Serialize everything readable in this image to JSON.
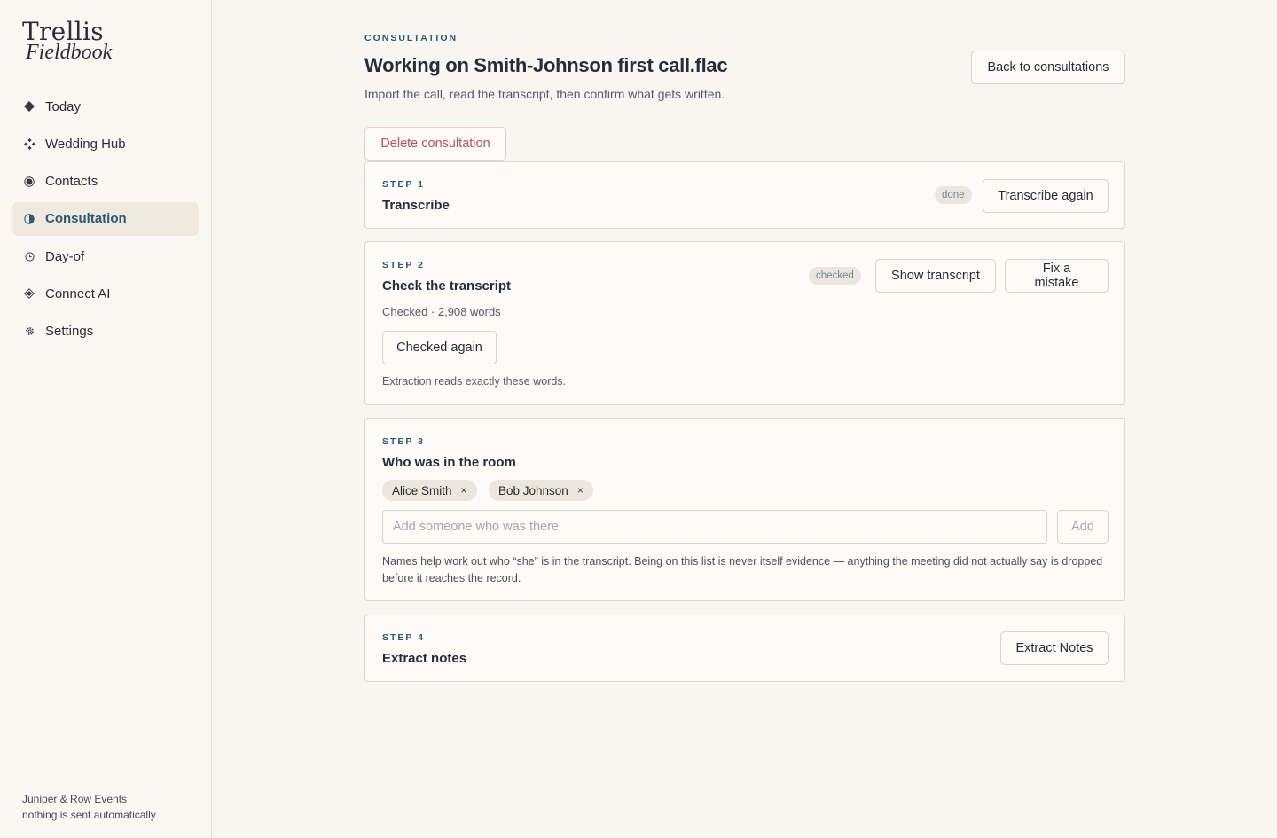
{
  "brand": {
    "name": "Trellis",
    "sub": "Fieldbook"
  },
  "nav": [
    {
      "label": "Today",
      "icon": "diamond-icon"
    },
    {
      "label": "Wedding Hub",
      "icon": "sparkle-cluster-icon"
    },
    {
      "label": "Contacts",
      "icon": "dot-circle-icon"
    },
    {
      "label": "Consultation",
      "icon": "half-circle-icon",
      "active": true
    },
    {
      "label": "Day-of",
      "icon": "clock-icon"
    },
    {
      "label": "Connect AI",
      "icon": "diamond-outline-icon"
    },
    {
      "label": "Settings",
      "icon": "gear-icon"
    }
  ],
  "footer": {
    "org": "Juniper & Row Events",
    "note": "nothing is sent automatically"
  },
  "header": {
    "kicker": "CONSULTATION",
    "title": "Working on Smith-Johnson first call.flac",
    "subtitle": "Import the call, read the transcript, then confirm what gets written.",
    "back_label": "Back to consultations",
    "delete_label": "Delete consultation"
  },
  "steps": {
    "s1": {
      "label": "STEP 1",
      "title": "Transcribe",
      "badge": "done",
      "action": "Transcribe again"
    },
    "s2": {
      "label": "STEP 2",
      "title": "Check the transcript",
      "badge": "checked",
      "show_label": "Show transcript",
      "fix_label": "Fix a mistake",
      "status": "Checked · 2,908 words",
      "again_label": "Checked again",
      "note": "Extraction reads exactly these words."
    },
    "s3": {
      "label": "STEP 3",
      "title": "Who was in the room",
      "people": [
        "Alice Smith",
        "Bob Johnson"
      ],
      "remove_glyph": "×",
      "placeholder": "Add someone who was there",
      "add_label": "Add",
      "note": "Names help work out who “she” is in the transcript. Being on this list is never itself evidence — anything the meeting did not actually say is dropped before it reaches the record."
    },
    "s4": {
      "label": "STEP 4",
      "title": "Extract notes",
      "action": "Extract Notes"
    }
  }
}
